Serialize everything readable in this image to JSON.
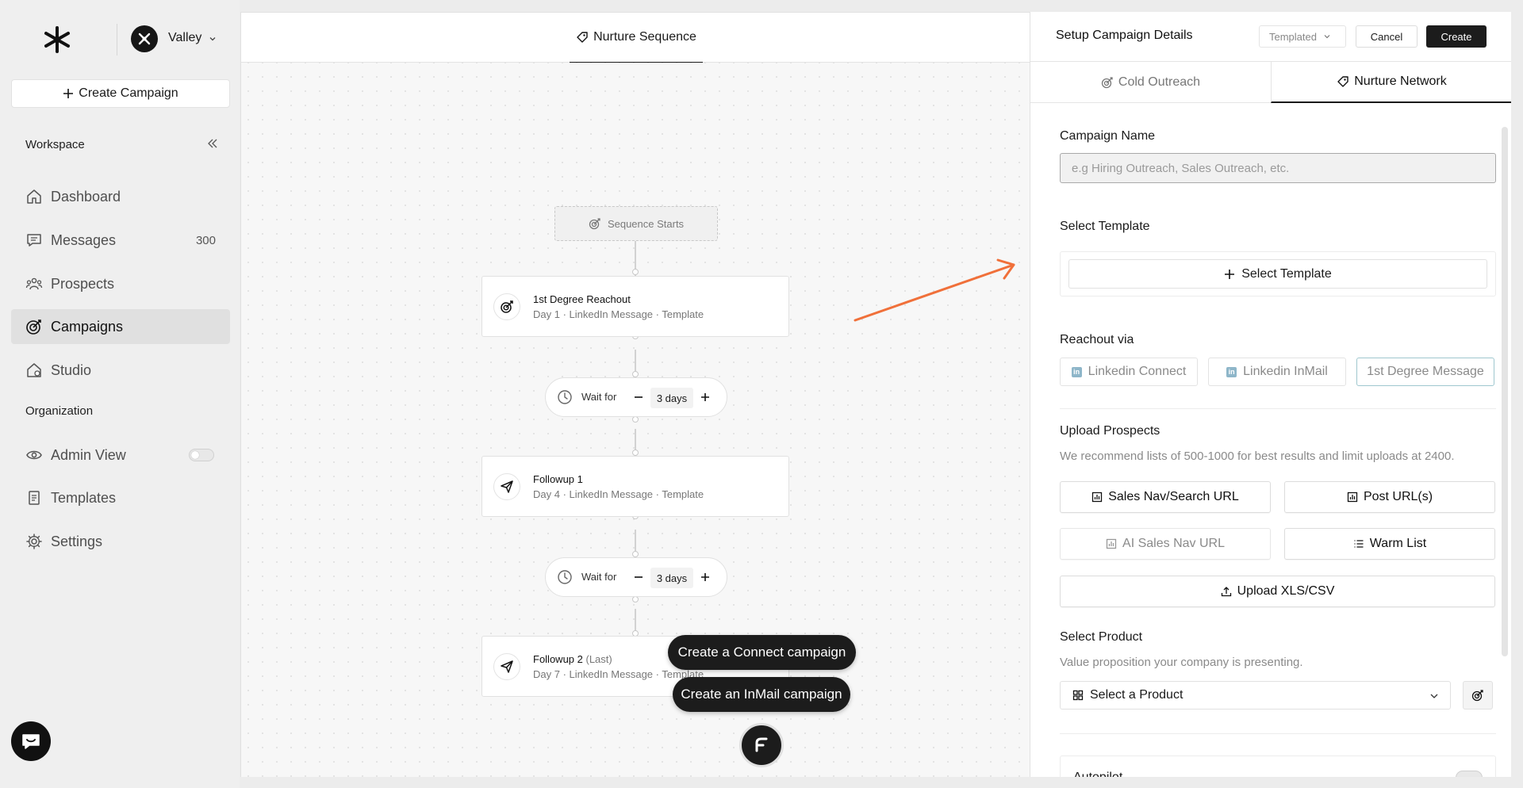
{
  "sidebar": {
    "workspace_name": "Valley",
    "create_campaign_label": "Create Campaign",
    "workspace_section": "Workspace",
    "organization_section": "Organization",
    "nav": {
      "dashboard": "Dashboard",
      "messages": "Messages",
      "messages_count": "300",
      "prospects": "Prospects",
      "campaigns": "Campaigns",
      "studio": "Studio",
      "admin_view": "Admin View",
      "templates": "Templates",
      "settings": "Settings"
    },
    "active_item": "Campaigns",
    "admin_view_enabled": false
  },
  "canvas": {
    "tab_label": "Nurture Sequence",
    "sequence_start": "Sequence Starts",
    "steps": [
      {
        "title": "1st Degree Reachout",
        "suffix": "",
        "subtitle": "Day 1 · LinkedIn Message · Template",
        "icon": "target-icon"
      },
      {
        "title": "Followup 1",
        "suffix": "",
        "subtitle": "Day 4 · LinkedIn Message · Template",
        "icon": "send-icon"
      },
      {
        "title": "Followup 2",
        "suffix": "(Last)",
        "subtitle": "Day 7 · LinkedIn Message · Template",
        "icon": "send-icon"
      }
    ],
    "waits": [
      {
        "label": "Wait for",
        "value": "3 days"
      },
      {
        "label": "Wait for",
        "value": "3 days"
      }
    ],
    "floating_buttons": {
      "connect": "Create a Connect campaign",
      "inmail": "Create an InMail campaign"
    }
  },
  "panel": {
    "title": "Setup Campaign Details",
    "template_mode": "Templated",
    "cancel_label": "Cancel",
    "create_label": "Create",
    "tabs": {
      "cold": "Cold Outreach",
      "nurture": "Nurture Network"
    },
    "active_tab": "Nurture Network",
    "campaign_name_label": "Campaign Name",
    "campaign_name_placeholder": "e.g Hiring Outreach, Sales Outreach, etc.",
    "campaign_name_value": "",
    "select_template_label": "Select Template",
    "select_template_button": "Select Template",
    "reachout_label": "Reachout via",
    "reachout_options": [
      "Linkedin Connect",
      "Linkedin InMail",
      "1st Degree Message"
    ],
    "reachout_selected": "1st Degree Message",
    "upload_label": "Upload Prospects",
    "upload_hint": "We recommend lists of 500-1000 for best results and limit uploads at 2400.",
    "upload_options": {
      "sales_nav": "Sales Nav/Search URL",
      "post_urls": "Post URL(s)",
      "ai_sales_nav": "AI Sales Nav URL",
      "warm_list": "Warm List",
      "upload_file": "Upload XLS/CSV"
    },
    "product_label": "Select Product",
    "product_hint": "Value proposition your company is presenting.",
    "product_placeholder": "Select a Product",
    "autopilot_label": "Autopilot"
  },
  "colors": {
    "accent_arrow": "#f0703a",
    "dark": "#1c1c1c",
    "selected_outline": "#9fc7cf",
    "linkedin_icon": "#8eb6c9"
  }
}
